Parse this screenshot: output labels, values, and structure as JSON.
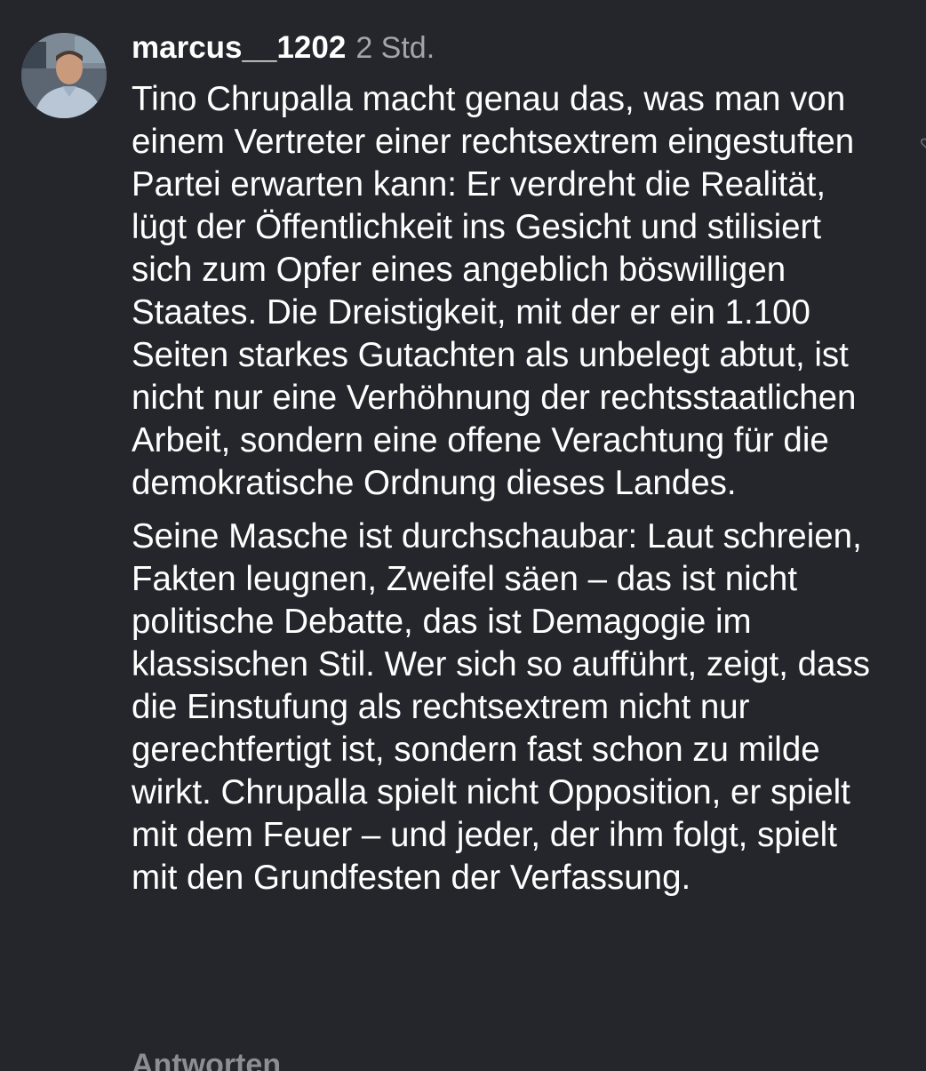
{
  "comment": {
    "username": "marcus__1202",
    "time": "2 Std.",
    "paragraphs": [
      "Tino Chrupalla macht genau das, was man von einem Vertreter einer rechtsextrem eingestuften Partei erwarten kann: Er verdreht die Realität, lügt der Öffentlichkeit ins Gesicht und stilisiert sich zum Opfer eines angeblich böswilligen Staates. Die Dreistigkeit, mit der er ein 1.100 Seiten starkes Gutachten als unbelegt abtut, ist nicht nur eine Verhöhnung der rechtsstaatlichen Arbeit, sondern eine offene Verachtung für die demokratische Ordnung dieses Landes.",
      "Seine Masche ist durchschaubar: Laut schreien, Fakten leugnen, Zweifel säen – das ist nicht politische Debatte, das ist Demagogie im klassischen Stil. Wer sich so aufführt, zeigt, dass die Einstufung als rechtsextrem nicht nur gerechtfertigt ist, sondern fast schon zu milde wirkt. Chrupalla spielt nicht Opposition, er spielt mit dem Feuer – und jeder, der ihm folgt, spielt mit den Grundfesten der Verfassung."
    ],
    "reply_label": "Antworten",
    "icons": {
      "avatar": "user-avatar-photo",
      "like": "heart-icon"
    }
  },
  "colors": {
    "background": "#25262b",
    "text": "#ffffff",
    "muted": "#a3a5ab"
  }
}
